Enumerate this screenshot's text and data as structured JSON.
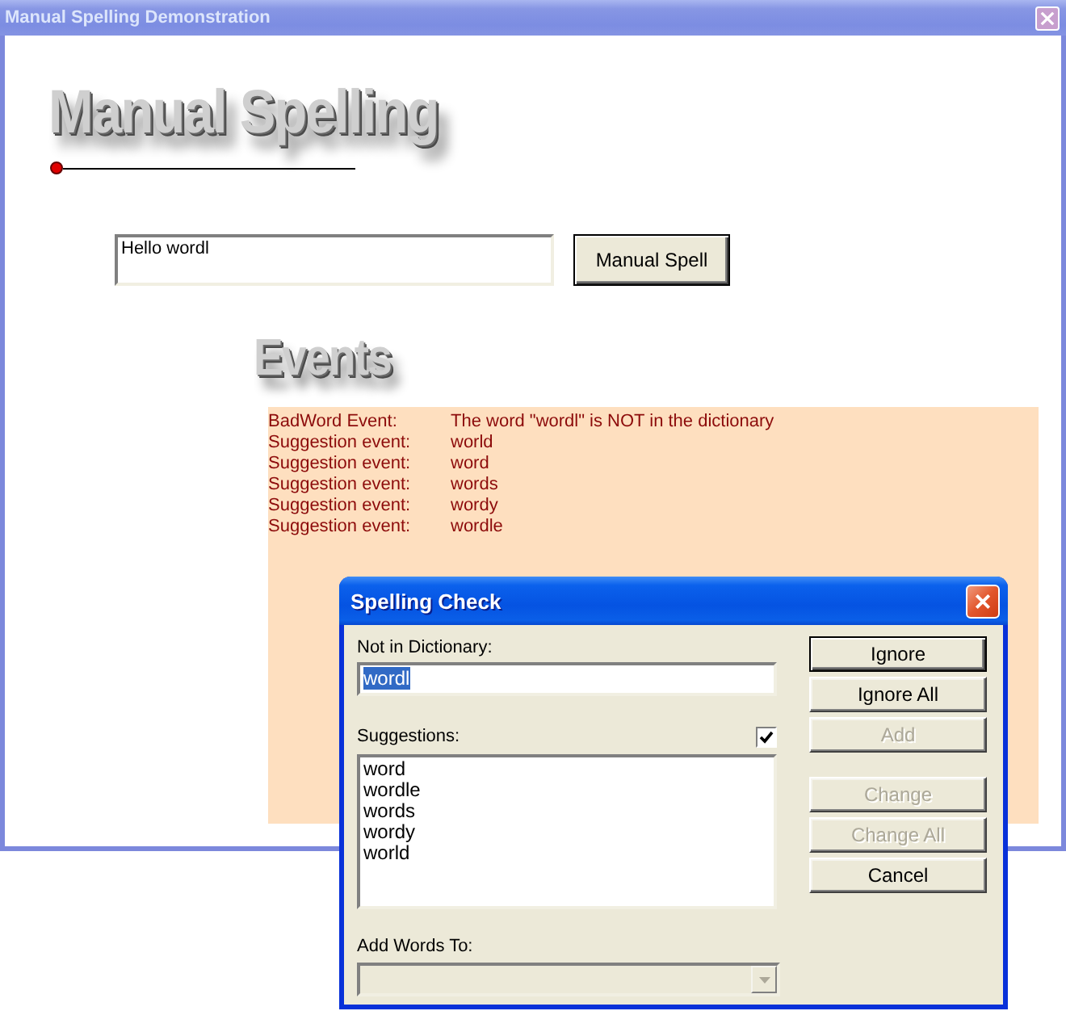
{
  "window": {
    "title": "Manual Spelling Demonstration",
    "active": false
  },
  "heading": "Manual Spelling",
  "text_field": {
    "value": "Hello wordl"
  },
  "manual_spell_button": {
    "label": "Manual Spell",
    "default": true
  },
  "events": {
    "heading": "Events",
    "rows": [
      {
        "event": "BadWord Event:",
        "detail": "The word \"wordl\" is NOT in the dictionary"
      },
      {
        "event": "Suggestion event:",
        "detail": "world"
      },
      {
        "event": "Suggestion event:",
        "detail": "word"
      },
      {
        "event": "Suggestion event:",
        "detail": "words"
      },
      {
        "event": "Suggestion event:",
        "detail": "wordy"
      },
      {
        "event": "Suggestion event:",
        "detail": "wordle"
      }
    ]
  },
  "dialog": {
    "title": "Spelling Check",
    "active": true,
    "not_in_dictionary": {
      "label": "Not in Dictionary:",
      "value": "wordl",
      "selected": true
    },
    "suggestions": {
      "label": "Suggestions:",
      "checked": true,
      "items": [
        {
          "label": "word",
          "selected": false
        },
        {
          "label": "wordle",
          "selected": false
        },
        {
          "label": "words",
          "selected": false
        },
        {
          "label": "wordy",
          "selected": false
        },
        {
          "label": "world",
          "selected": false
        }
      ]
    },
    "add_words_to": {
      "label": "Add Words To:",
      "disabled": true
    },
    "button_groups": [
      {
        "buttons": [
          {
            "label": "Ignore",
            "default": true,
            "disabled": false
          },
          {
            "label": "Ignore All",
            "default": false,
            "disabled": false
          },
          {
            "label": "Add",
            "default": false,
            "disabled": true
          }
        ]
      },
      {
        "buttons": [
          {
            "label": "Change",
            "default": false,
            "disabled": true
          },
          {
            "label": "Change All",
            "default": false,
            "disabled": true
          },
          {
            "label": "Cancel",
            "default": false,
            "disabled": false
          }
        ]
      }
    ]
  }
}
